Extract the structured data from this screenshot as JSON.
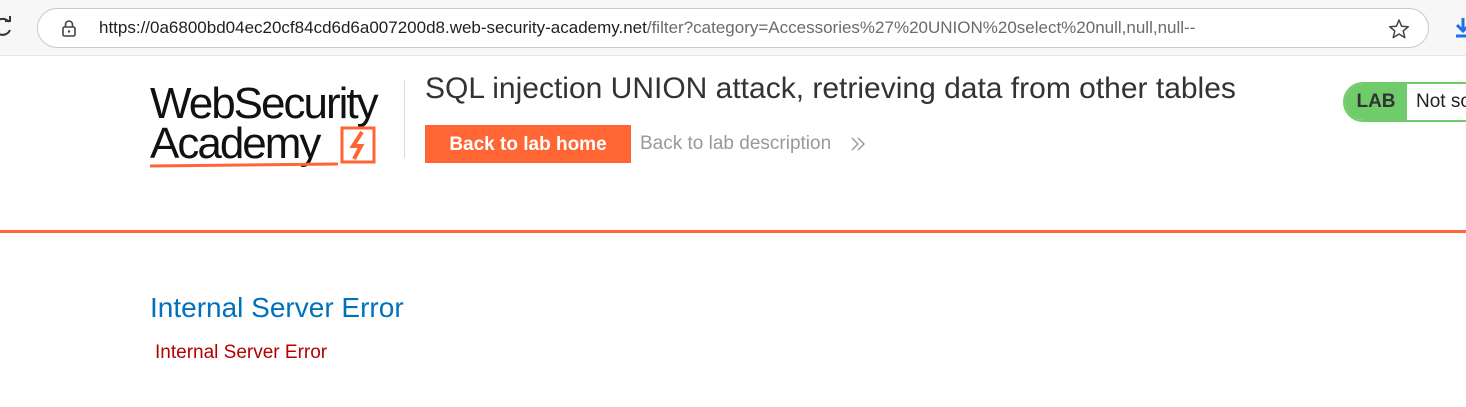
{
  "browser": {
    "url_host": "https://0a6800bd04ec20cf84cd6d6a007200d8.web-security-academy.net",
    "url_path": "/filter?category=Accessories%27%20UNION%20select%20null,null,null--",
    "icons": [
      "reload-icon",
      "lock-icon",
      "star-icon",
      "download-icon"
    ]
  },
  "header": {
    "logo_line_1": "WebSecurity",
    "logo_line_2": "Academy",
    "lab_title": "SQL injection UNION attack, retrieving data from other tables",
    "back_home_label": "Back to lab home",
    "back_description_label": "Back to lab description",
    "lab_badge": "LAB",
    "lab_status": "Not solved"
  },
  "content": {
    "error_heading": "Internal Server Error",
    "error_message": "Internal Server Error"
  },
  "colors": {
    "accent": "#ff6633",
    "heading_blue": "#0071bc",
    "error_red": "#b50000",
    "lab_green": "#70cc6a"
  }
}
